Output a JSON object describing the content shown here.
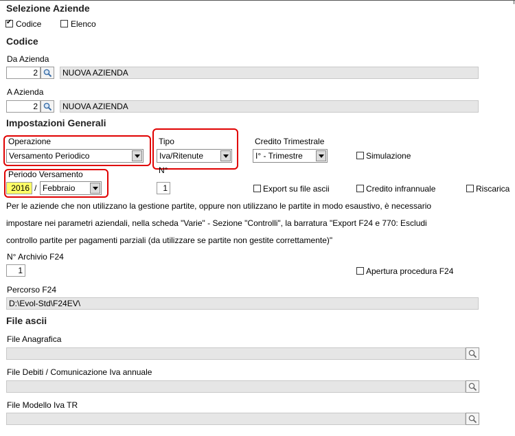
{
  "sel_aziende": {
    "title": "Selezione Aziende",
    "codice_label": "Codice",
    "codice_checked": true,
    "elenco_label": "Elenco",
    "elenco_checked": false
  },
  "codice": {
    "title": "Codice",
    "da_label": "Da Azienda",
    "da_value": "2",
    "da_name": "NUOVA AZIENDA",
    "a_label": "A  Azienda",
    "a_value": "2",
    "a_name": "NUOVA AZIENDA"
  },
  "impostazioni": {
    "title": "Impostazioni Generali",
    "operazione_label": "Operazione",
    "operazione_value": "Versamento Periodico",
    "tipo_label": "Tipo",
    "tipo_value": "Iva/Ritenute",
    "credito_trim_label": "Credito Trimestrale",
    "credito_trim_value": "I° - Trimestre",
    "simulazione_label": "Simulazione",
    "periodo_label": "Periodo Versamento",
    "anno_value": "2016",
    "separator": "/",
    "mese_value": "Febbraio",
    "n_label": "N°",
    "n_value": "1",
    "export_label": "Export su file ascii",
    "credito_infra_label": "Credito infrannuale",
    "riscarica_label": "Riscarica"
  },
  "note": {
    "line1": "Per le aziende che non utilizzano la gestione partite, oppure non utilizzano le partite in modo esaustivo, è necessario",
    "line2": "impostare nei parametri aziendali, nella scheda \"Varie\" - Sezione \"Controlli\", la barratura \"Export F24 e 770: Escludi",
    "line3": "controllo partite per pagamenti parziali (da utilizzare se partite non gestite correttamente)\""
  },
  "archivio": {
    "label": "N° Archivio F24",
    "value": "1",
    "apertura_label": "Apertura procedura F24"
  },
  "percorso": {
    "label": "Percorso F24",
    "value": "D:\\Evol-Std\\F24EV\\"
  },
  "file_ascii": {
    "title": "File ascii",
    "anagrafica_label": "File Anagrafica",
    "anagrafica_value": "",
    "debiti_label": "File Debiti / Comunicazione Iva annuale",
    "debiti_value": "",
    "modello_label": "File Modello Iva TR",
    "modello_value": ""
  }
}
